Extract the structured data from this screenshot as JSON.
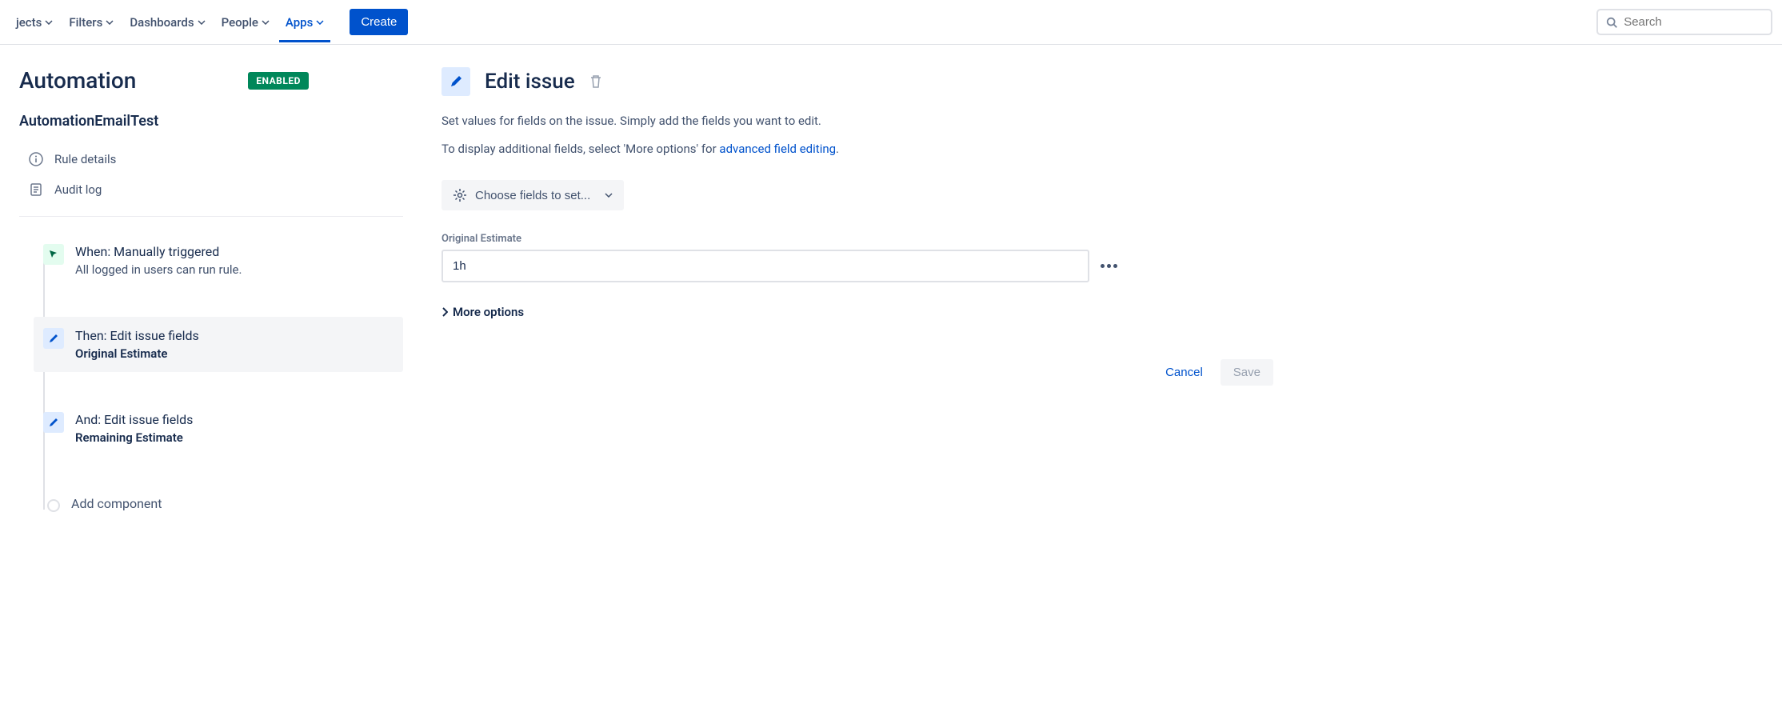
{
  "nav": {
    "items": [
      {
        "label": "jects",
        "active": false
      },
      {
        "label": "Filters",
        "active": false
      },
      {
        "label": "Dashboards",
        "active": false
      },
      {
        "label": "People",
        "active": false
      },
      {
        "label": "Apps",
        "active": true
      }
    ],
    "create_label": "Create",
    "search_placeholder": "Search"
  },
  "sidebar": {
    "title": "Automation",
    "badge": "ENABLED",
    "rule_name": "AutomationEmailTest",
    "links": {
      "rule_details": "Rule details",
      "audit_log": "Audit log"
    },
    "chain": {
      "when": {
        "title": "When: Manually triggered",
        "sub": "All logged in users can run rule."
      },
      "then": {
        "title": "Then: Edit issue fields",
        "sub": "Original Estimate"
      },
      "and": {
        "title": "And: Edit issue fields",
        "sub": "Remaining Estimate"
      },
      "add": {
        "title": "Add component"
      }
    }
  },
  "panel": {
    "title": "Edit issue",
    "desc1": "Set values for fields on the issue. Simply add the fields you want to edit.",
    "desc2_pre": "To display additional fields, select 'More options' for ",
    "desc2_link": "advanced field editing",
    "desc2_post": ".",
    "choose_fields": "Choose fields to set...",
    "field_label": "Original Estimate",
    "field_value": "1h",
    "more_options": "More options",
    "cancel": "Cancel",
    "save": "Save"
  }
}
